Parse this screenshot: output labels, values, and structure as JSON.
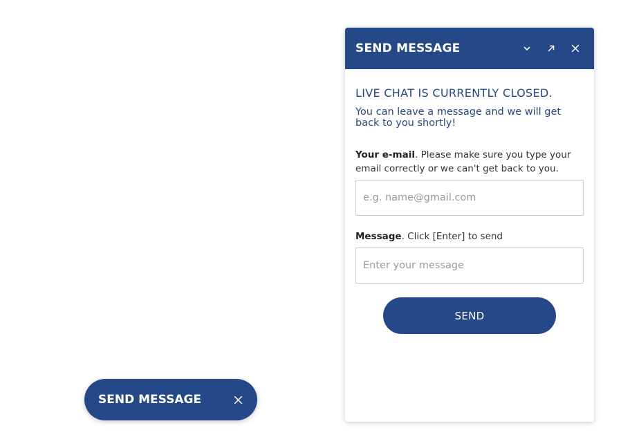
{
  "chat_window": {
    "header": {
      "title": "SEND MESSAGE",
      "buttons": [
        "chevron-down-icon",
        "expand-arrow-icon",
        "close-icon"
      ]
    },
    "status_title": "LIVE CHAT IS CURRENTLY CLOSED.",
    "status_subtitle": "You can leave a message and we will get back to you shortly!",
    "email": {
      "label_bold": "Your e-mail",
      "label_rest": ". Please make sure you type your email correctly or we can't get back to you.",
      "value": "",
      "placeholder": "e.g. name@gmail.com"
    },
    "message": {
      "label_bold": "Message",
      "label_rest": ". Click [Enter] to send",
      "value": "",
      "placeholder": "Enter your message"
    },
    "send_label": "SEND"
  },
  "launcher": {
    "label": "SEND MESSAGE",
    "icon": "close-icon"
  },
  "colors": {
    "brand": "#254888",
    "background": "#ffffff",
    "input_border": "#c9c9c9",
    "placeholder": "#9a9a9a"
  }
}
